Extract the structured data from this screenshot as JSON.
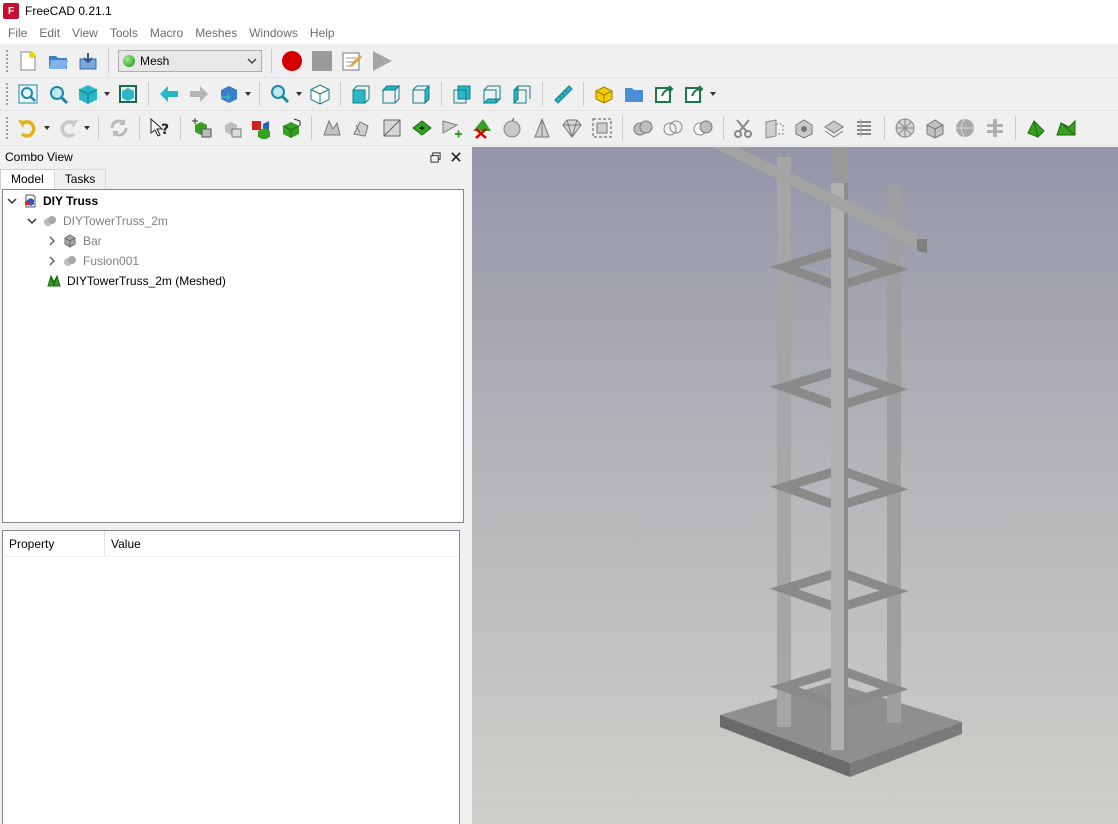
{
  "titlebar": {
    "title": "FreeCAD 0.21.1"
  },
  "menubar": {
    "items": [
      "File",
      "Edit",
      "View",
      "Tools",
      "Macro",
      "Meshes",
      "Windows",
      "Help"
    ]
  },
  "workbench": {
    "selected": "Mesh"
  },
  "combo_view": {
    "title": "Combo View",
    "tabs": [
      "Model",
      "Tasks"
    ],
    "tree": [
      {
        "label": "DIY Truss",
        "icon": "document-icon"
      },
      {
        "label": "DIYTowerTruss_2m",
        "icon": "fusion-icon"
      },
      {
        "label": "Bar",
        "icon": "part-icon"
      },
      {
        "label": "Fusion001",
        "icon": "fusion-icon"
      },
      {
        "label": "DIYTowerTruss_2m (Meshed)",
        "icon": "mesh-icon"
      }
    ]
  },
  "property_editor": {
    "columns": [
      "Property",
      "Value"
    ]
  },
  "colors": {
    "accent": "#29b6c6",
    "record": "#d40000",
    "mesh_green": "#2f9a1c"
  }
}
